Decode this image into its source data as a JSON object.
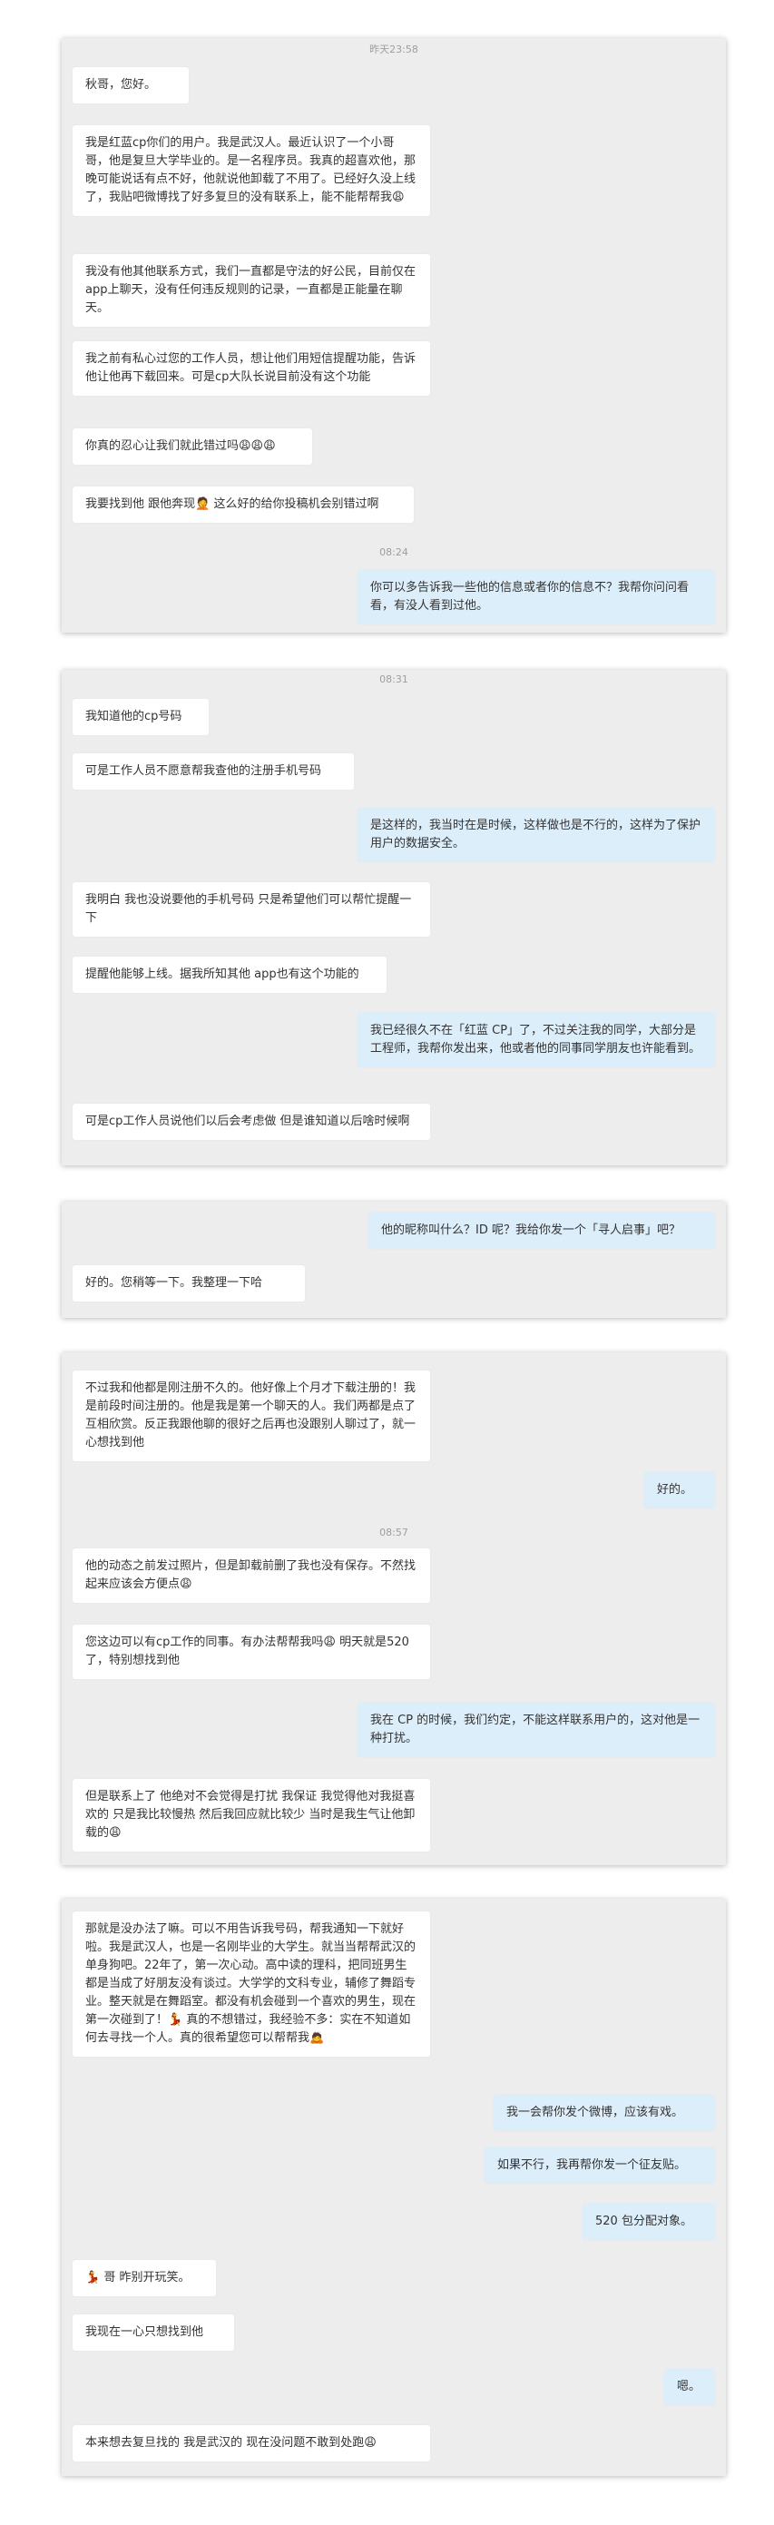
{
  "panel1": {
    "timestamp_top": "昨天23:58",
    "timestamp_mid": "08:24",
    "messages": [
      "秋哥，您好。",
      "我是红蓝cp你们的用户。我是武汉人。最近认识了一个小哥哥，他是复旦大学毕业的。是一名程序员。我真的超喜欢他，那晚可能说话有点不好，他就说他卸载了不用了。已经好久没上线了，我贴吧微博找了好多复旦的没有联系上，能不能帮帮我😩",
      "我没有他其他联系方式，我们一直都是守法的好公民，目前仅在app上聊天，没有任何违反规则的记录，一直都是正能量在聊天。",
      "我之前有私心过您的工作人员，想让他们用短信提醒功能，告诉他让他再下载回来。可是cp大队长说目前没有这个功能",
      "你真的忍心让我们就此错过吗😩😩😩",
      "我要找到他 跟他奔现🤦 这么好的给你投稿机会别错过啊",
      "你可以多告诉我一些他的信息或者你的信息不？我帮你问问看看，有没人看到过他。"
    ]
  },
  "panel2": {
    "timestamp": "08:31",
    "messages": [
      "我知道他的cp号码",
      "可是工作人员不愿意帮我查他的注册手机号码",
      "是这样的，我当时在是时候，这样做也是不行的，这样为了保护用户的数据安全。",
      "我明白 我也没说要他的手机号码 只是希望他们可以帮忙提醒一下",
      "提醒他能够上线。据我所知其他 app也有这个功能的",
      "我已经很久不在「红蓝 CP」了，不过关注我的同学，大部分是工程师，我帮你发出来，他或者他的同事同学朋友也许能看到。",
      "可是cp工作人员说他们以后会考虑做 但是谁知道以后啥时候啊"
    ]
  },
  "panel3": {
    "messages": [
      "他的昵称叫什么？ID 呢？我给你发一个「寻人启事」吧？",
      "好的。您稍等一下。我整理一下哈"
    ]
  },
  "panel4": {
    "timestamp": "08:57",
    "messages": [
      "不过我和他都是刚注册不久的。他好像上个月才下载注册的！我是前段时间注册的。他是我是第一个聊天的人。我们两都是点了互相欣赏。反正我跟他聊的很好之后再也没跟别人聊过了，就一心想找到他",
      "好的。",
      "他的动态之前发过照片，但是卸载前删了我也没有保存。不然找起来应该会方便点😩",
      "您这边可以有cp工作的同事。有办法帮帮我吗😩 明天就是520了，特别想找到他",
      "我在 CP 的时候，我们约定，不能这样联系用户的，这对他是一种打扰。",
      "但是联系上了 他绝对不会觉得是打扰 我保证 我觉得他对我挺喜欢的 只是我比较慢热 然后我回应就比较少 当时是我生气让他卸载的😩"
    ]
  },
  "panel5": {
    "messages": [
      "那就是没办法了嘛。可以不用告诉我号码，帮我通知一下就好啦。我是武汉人，也是一名刚毕业的大学生。就当当帮帮武汉的单身狗吧。22年了，第一次心动。高中读的理科，把同班男生都是当成了好朋友没有谈过。大学学的文科专业，辅修了舞蹈专业。整天就是在舞蹈室。都没有机会碰到一个喜欢的男生，现在第一次碰到了！💃 真的不想错过，我经验不多：实在不知道如何去寻找一个人。真的很希望您可以帮帮我🙇",
      "我一会帮你发个微博，应该有戏。",
      "如果不行，我再帮你发一个征友贴。",
      "520 包分配对象。",
      "💃 哥 昨别开玩笑。",
      "我现在一心只想找到他",
      "嗯。",
      "本来想去复旦找的 我是武汉的 现在没问题不敢到处跑😩"
    ]
  }
}
